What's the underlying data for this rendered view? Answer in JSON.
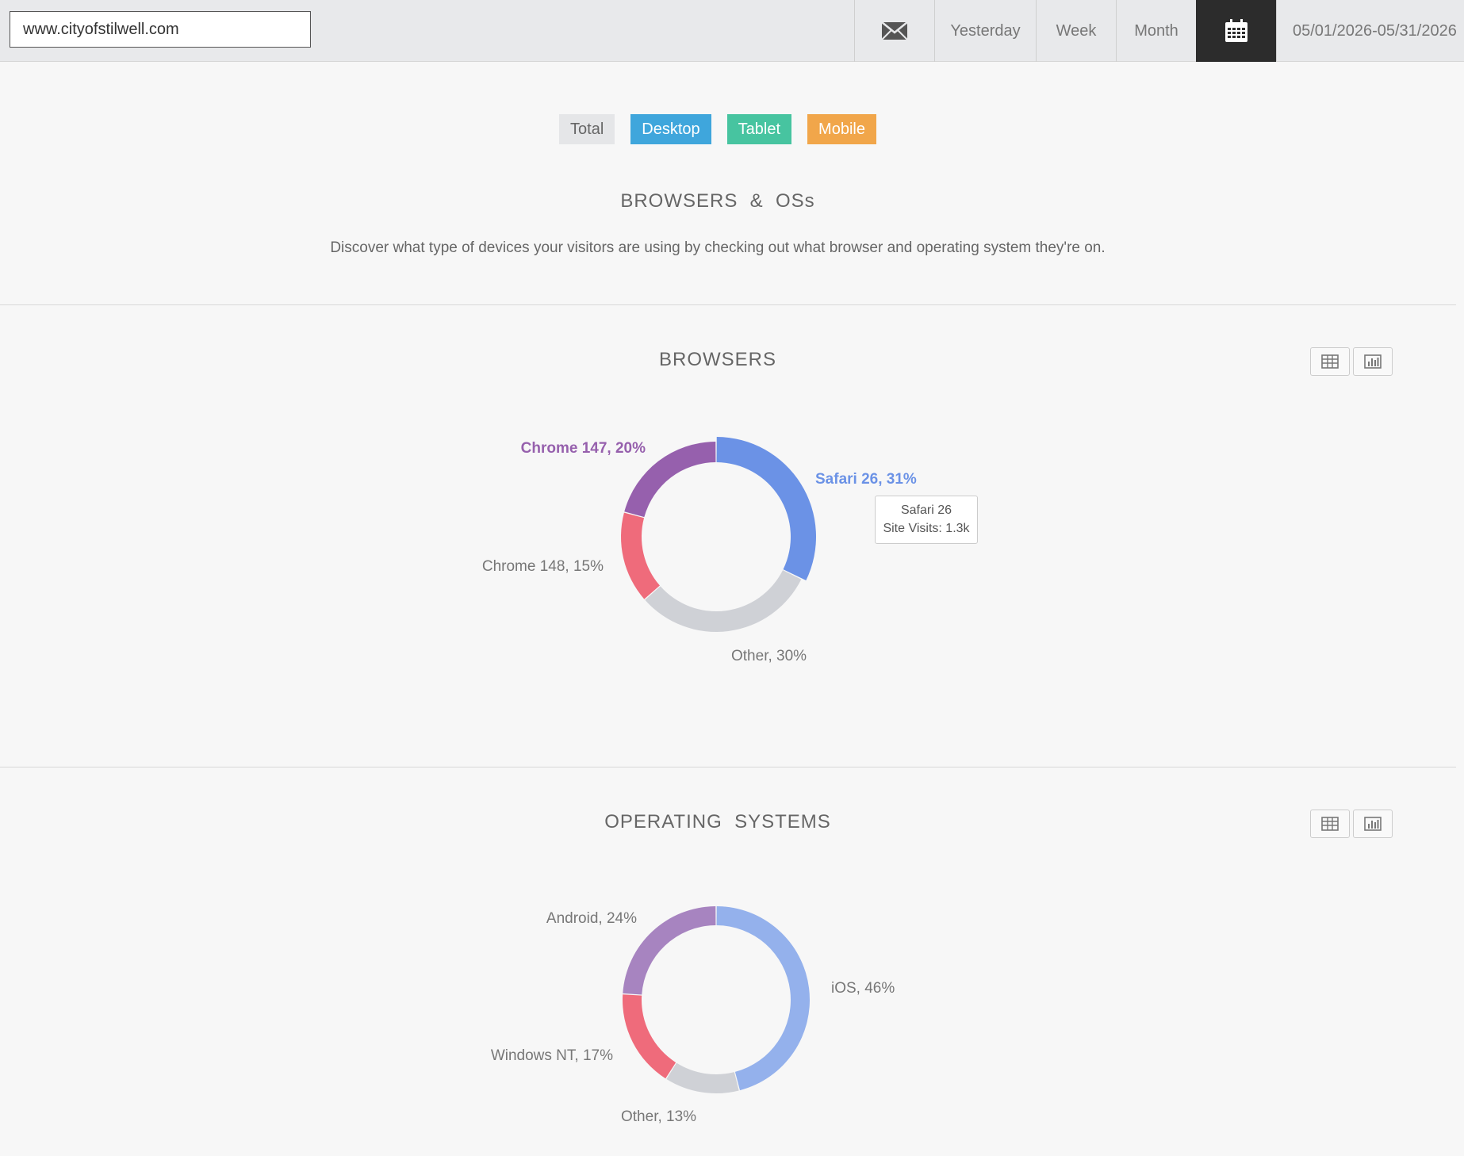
{
  "header": {
    "site_url": "www.cityofstilwell.com",
    "nav": {
      "yesterday": "Yesterday",
      "week": "Week",
      "month": "Month",
      "date_range": "05/01/2026-05/31/2026"
    }
  },
  "filters": {
    "total": "Total",
    "desktop": "Desktop",
    "tablet": "Tablet",
    "mobile": "Mobile"
  },
  "intro": {
    "title": "BROWSERS  &  OSs",
    "description": "Discover what type of devices your visitors are using by checking out what browser and operating system they're on."
  },
  "browsers": {
    "title": "BROWSERS",
    "tooltip": {
      "line1": "Safari 26",
      "line2": "Site Visits: 1.3k"
    }
  },
  "operating_systems": {
    "title": "OPERATING  SYSTEMS"
  },
  "colors": {
    "blue": "#6b92e6",
    "gray": "#cfd1d6",
    "red": "#ef6b7b",
    "purple": "#9660ad",
    "light_blue": "#94b1ec",
    "light_purple": "#a784c0"
  },
  "chart_data": [
    {
      "type": "pie",
      "title": "BROWSERS",
      "slices": [
        {
          "label": "Safari 26, 31%",
          "value": 31,
          "color": "#6b92e6",
          "highlight": true
        },
        {
          "label": "Other, 30%",
          "value": 30,
          "color": "#cfd1d6"
        },
        {
          "label": "Chrome 148, 15%",
          "value": 15,
          "color": "#ef6b7b"
        },
        {
          "label": "Chrome 147, 20%",
          "value": 20,
          "color": "#9660ad",
          "highlight": true
        }
      ]
    },
    {
      "type": "pie",
      "title": "OPERATING  SYSTEMS",
      "slices": [
        {
          "label": "iOS, 46%",
          "value": 46,
          "color": "#94b1ec"
        },
        {
          "label": "Other, 13%",
          "value": 13,
          "color": "#cfd1d6"
        },
        {
          "label": "Windows NT, 17%",
          "value": 17,
          "color": "#ef6b7b"
        },
        {
          "label": "Android, 24%",
          "value": 24,
          "color": "#a784c0"
        }
      ]
    }
  ]
}
